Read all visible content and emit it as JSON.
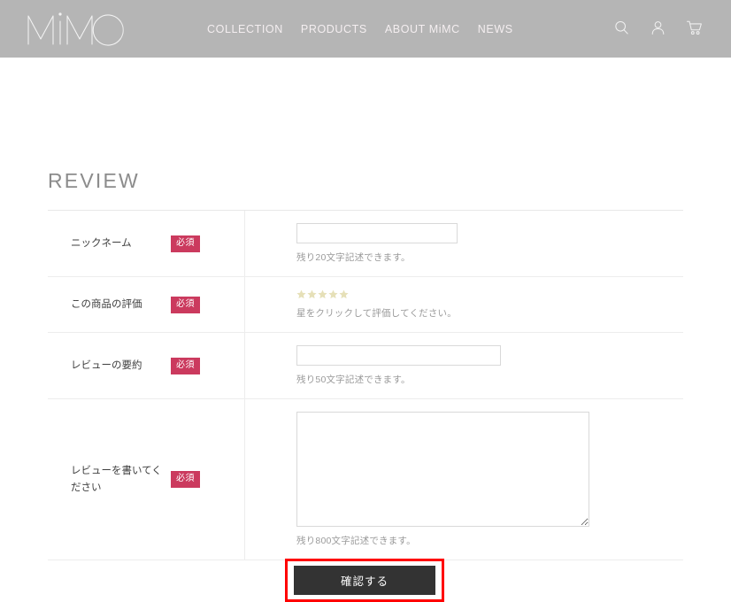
{
  "header": {
    "logo_text": "MiMC",
    "nav": [
      {
        "label": "COLLECTION"
      },
      {
        "label": "PRODUCTS"
      },
      {
        "label": "ABOUT MiMC"
      },
      {
        "label": "NEWS"
      }
    ],
    "icons": [
      {
        "name": "search-icon"
      },
      {
        "name": "account-icon"
      },
      {
        "name": "cart-icon"
      }
    ],
    "background_color": "#b5b5b5",
    "nav_text_color": "#f4eef0"
  },
  "page": {
    "title": "REVIEW"
  },
  "form": {
    "required_badge_label": "必須",
    "required_badge_color": "#cb3a5e",
    "rows": [
      {
        "label": "ニックネーム",
        "required": "必須",
        "input_value": "",
        "input_placeholder": "",
        "helper": "残り20文字記述できます。"
      },
      {
        "label": "この商品の評価",
        "required": "必須",
        "stars": 5,
        "stars_filled": 0,
        "star_color": "#e6e0b8",
        "helper": "星をクリックして評価してください。"
      },
      {
        "label": "レビューの要約",
        "required": "必須",
        "input_value": "",
        "input_placeholder": "",
        "helper": "残り50文字記述できます。"
      },
      {
        "label": "レビューを書いてください",
        "required": "必須",
        "input_value": "",
        "input_placeholder": "",
        "helper": "残り800文字記述できます。"
      }
    ]
  },
  "submit": {
    "label": "確認する",
    "button_color": "#333333",
    "highlight_color": "#ff0000"
  }
}
